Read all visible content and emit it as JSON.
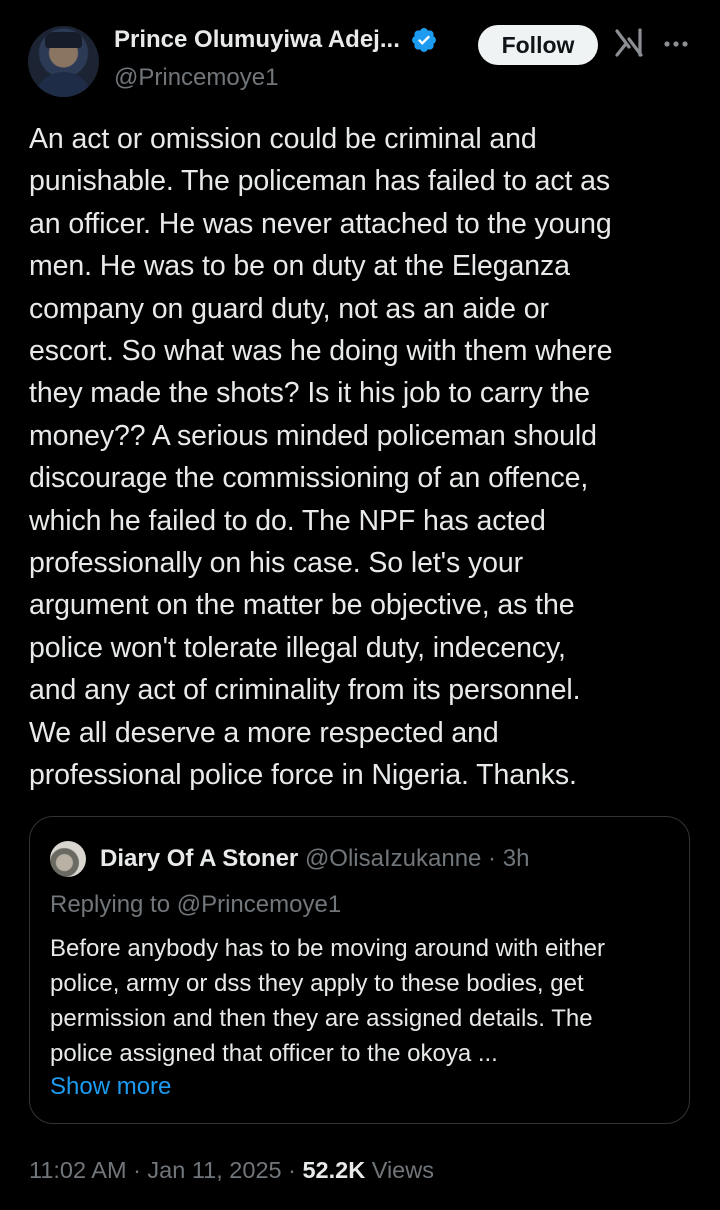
{
  "author": {
    "name": "Prince Olumuyiwa Adej...",
    "handle": "@Princemoye1",
    "verified": true
  },
  "header": {
    "follow_label": "Follow"
  },
  "tweet": {
    "text": "An act or omission could be criminal and\npunishable. The policeman has failed to act as\nan officer. He was never attached to the young\nmen. He was to be on duty at the Eleganza\ncompany on guard duty, not as an aide or\nescort. So what was he doing with them where\nthey made the shots? Is it his job to carry the\nmoney?? A serious minded policeman should\ndiscourage the commissioning of an offence,\nwhich he failed to do. The NPF has acted\nprofessionally on his case. So let's your\nargument on the matter be objective, as the\npolice won't tolerate illegal duty, indecency,\nand any act of criminality from its personnel.\nWe all deserve  a more respected and\nprofessional police force in Nigeria. Thanks."
  },
  "quote": {
    "name": "Diary Of A Stoner",
    "meta": "@OlisaIzukanne · 3h",
    "replying_to": "Replying to @Princemoye1",
    "text": "Before anybody has to be moving around with either\npolice, army or dss they apply to these bodies, get\npermission and then they are assigned details. The\npolice assigned that officer to the okoya ...",
    "show_more": "Show more"
  },
  "footer": {
    "timestamp": "11:02 AM · Jan 11, 2025 · ",
    "views_count": "52.2K",
    "views_label": " Views"
  },
  "colors": {
    "background": "#000000",
    "text": "#e7e9ea",
    "muted": "#71767b",
    "accent": "#1d9bf0",
    "border": "#2f3336"
  },
  "icons": [
    "verified-badge-icon",
    "grok-icon",
    "more-options-icon"
  ]
}
